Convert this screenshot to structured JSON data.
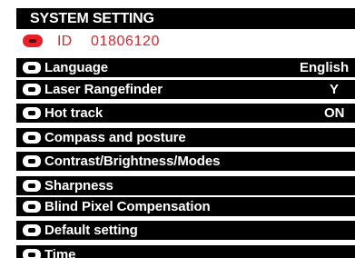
{
  "header": {
    "title": "SYSTEM SETTING"
  },
  "device": {
    "id_label": "ID",
    "id_value": "01806120",
    "id_icon": "red-bullet-icon",
    "accent_color": "#e8202a"
  },
  "menu": {
    "bullet_icon": "white-bullet-icon",
    "items": [
      {
        "label": "Language",
        "value": "English"
      },
      {
        "label": "Laser Rangefinder",
        "value": "Y"
      },
      {
        "label": "Hot track",
        "value": "ON"
      },
      {
        "label": "Compass and posture"
      },
      {
        "label": "Contrast/Brightness/Modes"
      },
      {
        "label": "Sharpness"
      },
      {
        "label": "Blind Pixel Compensation"
      },
      {
        "label": "Default setting"
      },
      {
        "label": "Time"
      }
    ]
  }
}
